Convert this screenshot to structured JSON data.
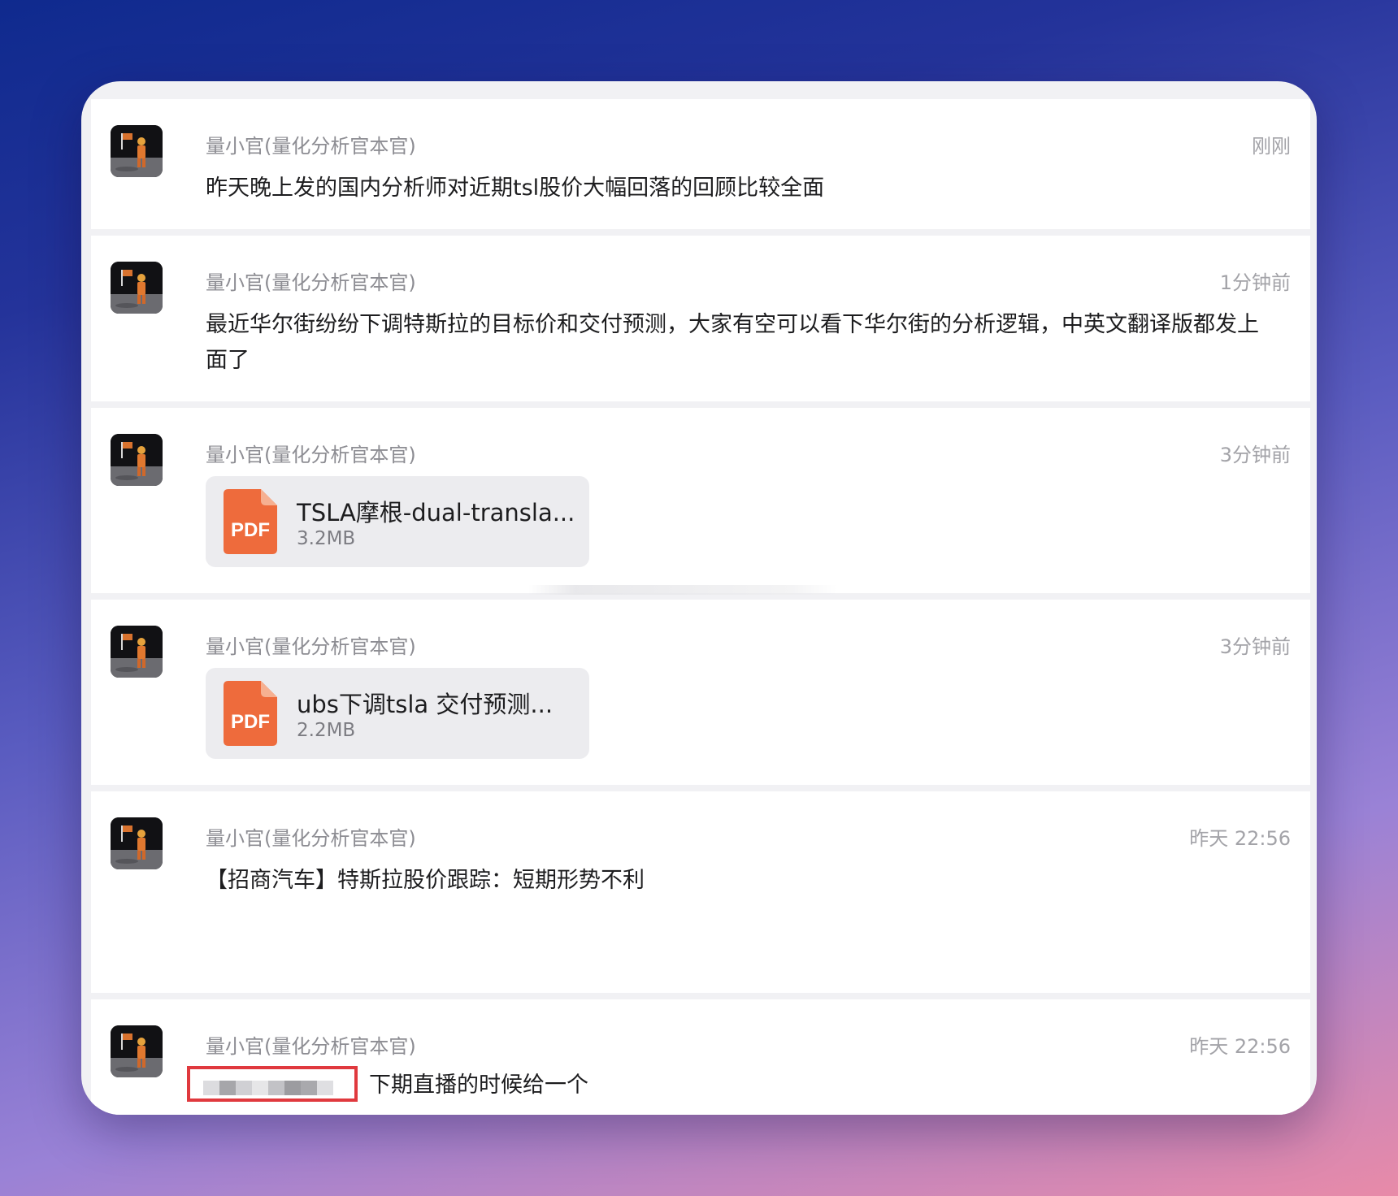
{
  "messages": [
    {
      "sender": "量小官(量化分析官本官)",
      "time": "刚刚",
      "text": "昨天晚上发的国内分析师对近期tsl股价大幅回落的回顾比较全面"
    },
    {
      "sender": "量小官(量化分析官本官)",
      "time": "1分钟前",
      "text": "最近华尔街纷纷下调特斯拉的目标价和交付预测，大家有空可以看下华尔街的分析逻辑，中英文翻译版都发上面了"
    },
    {
      "sender": "量小官(量化分析官本官)",
      "time": "3分钟前",
      "file": {
        "icon_label": "PDF",
        "name": "TSLA摩根-dual-transla...",
        "size": "3.2MB"
      }
    },
    {
      "sender": "量小官(量化分析官本官)",
      "time": "3分钟前",
      "file": {
        "icon_label": "PDF",
        "name": "ubs下调tsla 交付预测...",
        "size": "2.2MB"
      }
    },
    {
      "sender": "量小官(量化分析官本官)",
      "time": "昨天 22:56",
      "text": "【招商汽车】特斯拉股价跟踪：短期形势不利"
    },
    {
      "sender": "量小官(量化分析官本官)",
      "time": "昨天 22:56",
      "text": "下期直播的时候给一个"
    }
  ],
  "colors": {
    "pdf_icon": "#ee6b3c",
    "highlight_box": "#e0393e"
  },
  "icons": {
    "avatar": "astronaut-avatar-icon",
    "file": "pdf-file-icon"
  }
}
